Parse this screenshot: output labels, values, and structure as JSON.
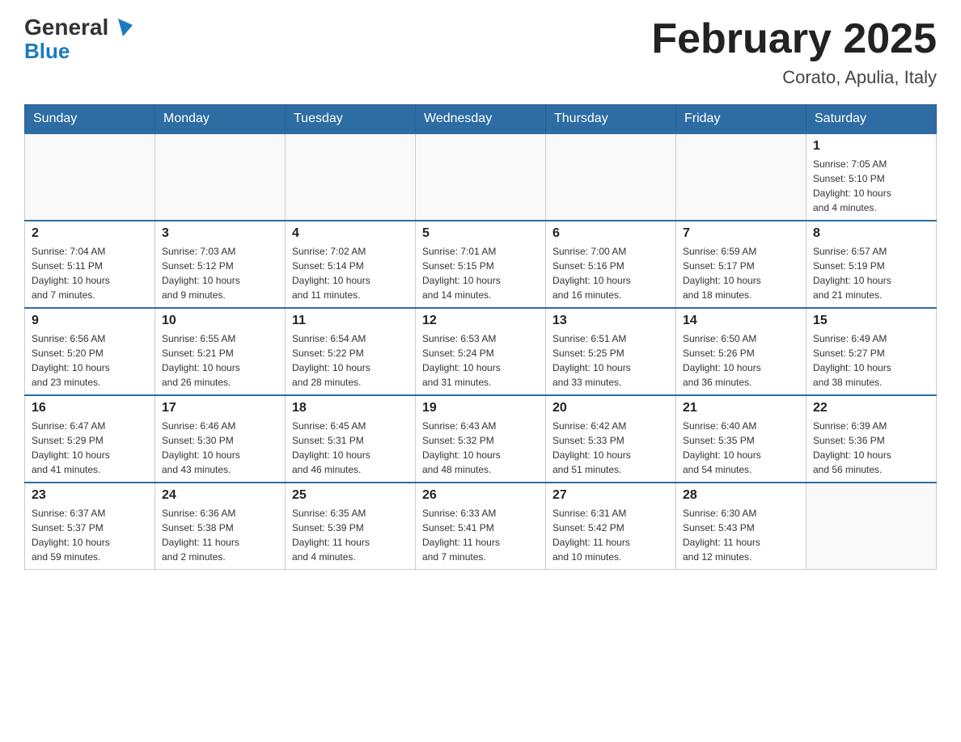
{
  "logo": {
    "general": "General",
    "blue": "Blue"
  },
  "title": "February 2025",
  "subtitle": "Corato, Apulia, Italy",
  "weekdays": [
    "Sunday",
    "Monday",
    "Tuesday",
    "Wednesday",
    "Thursday",
    "Friday",
    "Saturday"
  ],
  "weeks": [
    [
      {
        "day": "",
        "info": ""
      },
      {
        "day": "",
        "info": ""
      },
      {
        "day": "",
        "info": ""
      },
      {
        "day": "",
        "info": ""
      },
      {
        "day": "",
        "info": ""
      },
      {
        "day": "",
        "info": ""
      },
      {
        "day": "1",
        "info": "Sunrise: 7:05 AM\nSunset: 5:10 PM\nDaylight: 10 hours\nand 4 minutes."
      }
    ],
    [
      {
        "day": "2",
        "info": "Sunrise: 7:04 AM\nSunset: 5:11 PM\nDaylight: 10 hours\nand 7 minutes."
      },
      {
        "day": "3",
        "info": "Sunrise: 7:03 AM\nSunset: 5:12 PM\nDaylight: 10 hours\nand 9 minutes."
      },
      {
        "day": "4",
        "info": "Sunrise: 7:02 AM\nSunset: 5:14 PM\nDaylight: 10 hours\nand 11 minutes."
      },
      {
        "day": "5",
        "info": "Sunrise: 7:01 AM\nSunset: 5:15 PM\nDaylight: 10 hours\nand 14 minutes."
      },
      {
        "day": "6",
        "info": "Sunrise: 7:00 AM\nSunset: 5:16 PM\nDaylight: 10 hours\nand 16 minutes."
      },
      {
        "day": "7",
        "info": "Sunrise: 6:59 AM\nSunset: 5:17 PM\nDaylight: 10 hours\nand 18 minutes."
      },
      {
        "day": "8",
        "info": "Sunrise: 6:57 AM\nSunset: 5:19 PM\nDaylight: 10 hours\nand 21 minutes."
      }
    ],
    [
      {
        "day": "9",
        "info": "Sunrise: 6:56 AM\nSunset: 5:20 PM\nDaylight: 10 hours\nand 23 minutes."
      },
      {
        "day": "10",
        "info": "Sunrise: 6:55 AM\nSunset: 5:21 PM\nDaylight: 10 hours\nand 26 minutes."
      },
      {
        "day": "11",
        "info": "Sunrise: 6:54 AM\nSunset: 5:22 PM\nDaylight: 10 hours\nand 28 minutes."
      },
      {
        "day": "12",
        "info": "Sunrise: 6:53 AM\nSunset: 5:24 PM\nDaylight: 10 hours\nand 31 minutes."
      },
      {
        "day": "13",
        "info": "Sunrise: 6:51 AM\nSunset: 5:25 PM\nDaylight: 10 hours\nand 33 minutes."
      },
      {
        "day": "14",
        "info": "Sunrise: 6:50 AM\nSunset: 5:26 PM\nDaylight: 10 hours\nand 36 minutes."
      },
      {
        "day": "15",
        "info": "Sunrise: 6:49 AM\nSunset: 5:27 PM\nDaylight: 10 hours\nand 38 minutes."
      }
    ],
    [
      {
        "day": "16",
        "info": "Sunrise: 6:47 AM\nSunset: 5:29 PM\nDaylight: 10 hours\nand 41 minutes."
      },
      {
        "day": "17",
        "info": "Sunrise: 6:46 AM\nSunset: 5:30 PM\nDaylight: 10 hours\nand 43 minutes."
      },
      {
        "day": "18",
        "info": "Sunrise: 6:45 AM\nSunset: 5:31 PM\nDaylight: 10 hours\nand 46 minutes."
      },
      {
        "day": "19",
        "info": "Sunrise: 6:43 AM\nSunset: 5:32 PM\nDaylight: 10 hours\nand 48 minutes."
      },
      {
        "day": "20",
        "info": "Sunrise: 6:42 AM\nSunset: 5:33 PM\nDaylight: 10 hours\nand 51 minutes."
      },
      {
        "day": "21",
        "info": "Sunrise: 6:40 AM\nSunset: 5:35 PM\nDaylight: 10 hours\nand 54 minutes."
      },
      {
        "day": "22",
        "info": "Sunrise: 6:39 AM\nSunset: 5:36 PM\nDaylight: 10 hours\nand 56 minutes."
      }
    ],
    [
      {
        "day": "23",
        "info": "Sunrise: 6:37 AM\nSunset: 5:37 PM\nDaylight: 10 hours\nand 59 minutes."
      },
      {
        "day": "24",
        "info": "Sunrise: 6:36 AM\nSunset: 5:38 PM\nDaylight: 11 hours\nand 2 minutes."
      },
      {
        "day": "25",
        "info": "Sunrise: 6:35 AM\nSunset: 5:39 PM\nDaylight: 11 hours\nand 4 minutes."
      },
      {
        "day": "26",
        "info": "Sunrise: 6:33 AM\nSunset: 5:41 PM\nDaylight: 11 hours\nand 7 minutes."
      },
      {
        "day": "27",
        "info": "Sunrise: 6:31 AM\nSunset: 5:42 PM\nDaylight: 11 hours\nand 10 minutes."
      },
      {
        "day": "28",
        "info": "Sunrise: 6:30 AM\nSunset: 5:43 PM\nDaylight: 11 hours\nand 12 minutes."
      },
      {
        "day": "",
        "info": ""
      }
    ]
  ]
}
